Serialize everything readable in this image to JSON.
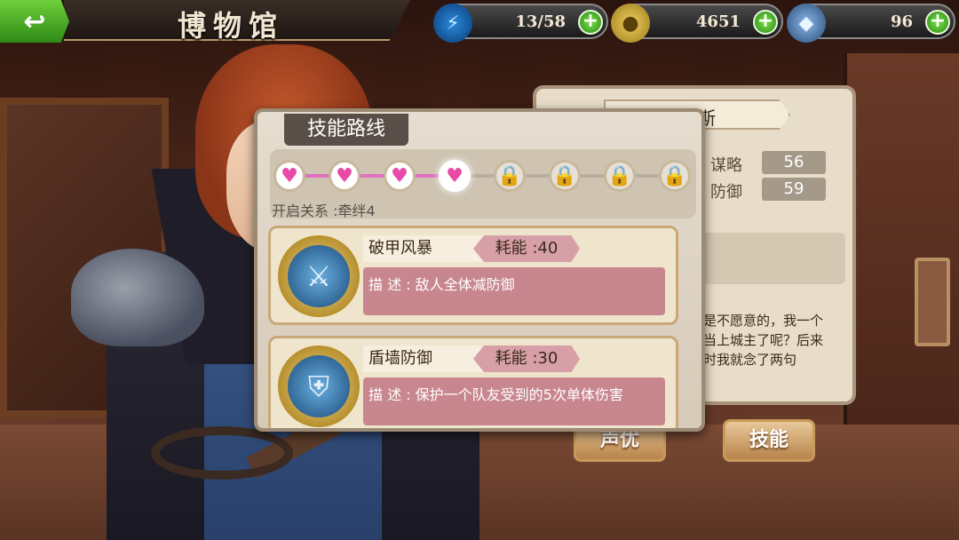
{
  "header": {
    "title": "博物馆",
    "resources": {
      "energy": "13/58",
      "gold": "4651",
      "gems": "96"
    }
  },
  "info_panel": {
    "name": "斯",
    "stats": [
      {
        "label": "谋略",
        "value": "56"
      },
      {
        "label": "防御",
        "value": "59"
      }
    ],
    "story": "是不愿意的，我一个\n当上城主了呢？后来\n时我就念了两句",
    "buttons": {
      "voice": "声优",
      "skill": "技能"
    }
  },
  "modal": {
    "title": "技能路线",
    "unlock_text": "开启关系 :牵绊4",
    "progress": {
      "unlocked": 4,
      "total": 8
    },
    "skills": [
      {
        "name": "破甲风暴",
        "cost": "耗能 :40",
        "description": "描 述 : 敌人全体减防御"
      },
      {
        "name": "盾墙防御",
        "cost": "耗能 :30",
        "description": "描 述 : 保护一个队友受到的5次单体伤害"
      }
    ]
  }
}
